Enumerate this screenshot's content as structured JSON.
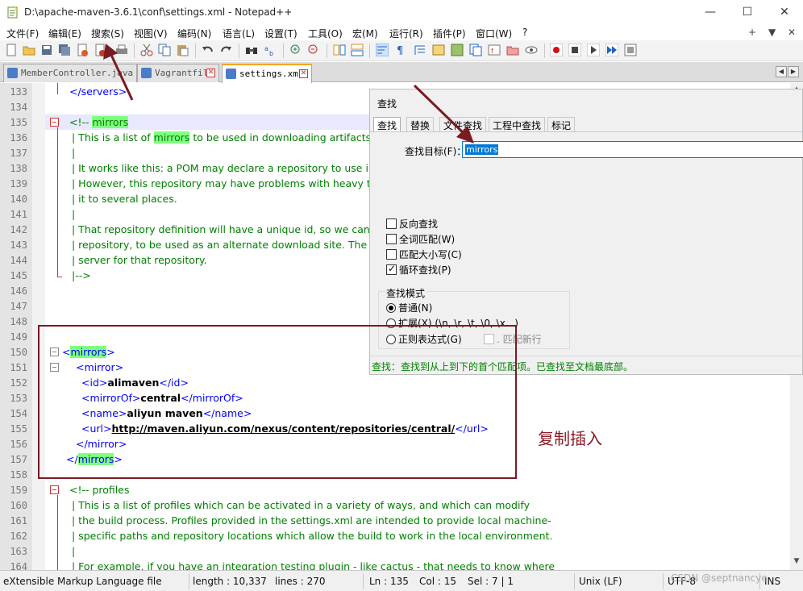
{
  "window": {
    "title": "D:\\apache-maven-3.6.1\\conf\\settings.xml - Notepad++",
    "controls": {
      "minimize": "—",
      "maximize": "☐",
      "close": "✕"
    }
  },
  "menu": {
    "items": [
      "文件(F)",
      "编辑(E)",
      "搜索(S)",
      "视图(V)",
      "编码(N)",
      "语言(L)",
      "设置(T)",
      "工具(O)",
      "宏(M)",
      "运行(R)",
      "插件(P)",
      "窗口(W)",
      "?"
    ],
    "right": [
      "+",
      "▼",
      "✕"
    ]
  },
  "tabs": [
    {
      "label": "MemberController.java",
      "active": false
    },
    {
      "label": "Vagrantfile",
      "active": false
    },
    {
      "label": "settings.xml",
      "active": true
    }
  ],
  "editor": {
    "line_numbers": [
      "133",
      "134",
      "135",
      "136",
      "137",
      "138",
      "139",
      "140",
      "141",
      "142",
      "143",
      "144",
      "145",
      "146",
      "147",
      "148",
      "149",
      "150",
      "151",
      "152",
      "153",
      "154",
      "155",
      "156",
      "157",
      "158",
      "159",
      "160",
      "161",
      "162",
      "163",
      "164"
    ],
    "lines": {
      "l133_tag": "</servers>",
      "l135_a": "<!-- ",
      "l135_b": "mirrors",
      "l136_a": "| This is a list of ",
      "l136_b": "mirrors",
      "l136_c": " to be used in downloading artifacts f",
      "l137": "|",
      "l138": "| It works like this: a POM may declare a repository to use in",
      "l139": "| However, this repository may have problems with heavy tra",
      "l140": "| it to several places.",
      "l141": "|",
      "l142": "| That repository definition will have a unique id, so we can c",
      "l143": "| repository, to be used as an alternate download site. The m",
      "l144": "| server for that repository.",
      "l145": "|-->",
      "l150_a": "<",
      "l150_b": "mirrors",
      "l150_c": ">",
      "l151": "<mirror>",
      "l152_open": "<id>",
      "l152_val": "alimaven",
      "l152_close": "</id>",
      "l153_open": "<mirrorOf>",
      "l153_val": "central",
      "l153_close": "</mirrorOf>",
      "l154_open": "<name>",
      "l154_val": "aliyun maven",
      "l154_close": "</name>",
      "l155_open": "<url>",
      "l155_val": "http://maven.aliyun.com/nexus/content/repositories/central/",
      "l155_close": "</url>",
      "l156": "</mirror>",
      "l157_a": "</",
      "l157_b": "mirrors",
      "l157_c": ">",
      "l159": "<!-- profiles",
      "l160": "| This is a list of profiles which can be activated in a variety of ways, and which can modify",
      "l161": "| the build process. Profiles provided in the settings.xml are intended to provide local machine-",
      "l162": "| specific paths and repository locations which allow the build to work in the local environment.",
      "l163": "|",
      "l164": "| For example, if you have an integration testing plugin - like cactus - that needs to know where"
    }
  },
  "find_dialog": {
    "title": "查找",
    "tabs": [
      "查找",
      "替换",
      "文件查找",
      "工程中查找",
      "标记"
    ],
    "label": "查找目标(F)：",
    "value": "mirrors",
    "options": [
      {
        "label": "反向查找",
        "checked": false
      },
      {
        "label": "全词匹配(W)",
        "checked": false
      },
      {
        "label": "匹配大小写(C)",
        "checked": false
      },
      {
        "label": "循环查找(P)",
        "checked": true
      }
    ],
    "mode_title": "查找模式",
    "modes": [
      {
        "label": "普通(N)",
        "checked": true
      },
      {
        "label": "扩展(X) (\\n, \\r, \\t, \\0, \\x...)",
        "checked": false
      },
      {
        "label": "正则表达式(G)",
        "checked": false
      }
    ],
    "dot_newline": ". 匹配新行",
    "status": "查找：查找到从上到下的首个匹配项。已查找至文档最底部。"
  },
  "annotation": {
    "text": "复制插入",
    "color": "#8b1a24"
  },
  "statusbar": {
    "filetype": "eXtensible Markup Language file",
    "length": "length : 10,337",
    "lines": "lines : 270",
    "ln": "Ln : 135",
    "col": "Col : 15",
    "sel": "Sel : 7 | 1",
    "eol": "Unix (LF)",
    "encoding": "UTF-8",
    "mode": "INS"
  },
  "watermark": "CSDN @septnancye",
  "colors": {
    "comment": "#008000",
    "tag": "#0000ff",
    "highlight": "#7fff7f",
    "annotation": "#7a1a23"
  }
}
